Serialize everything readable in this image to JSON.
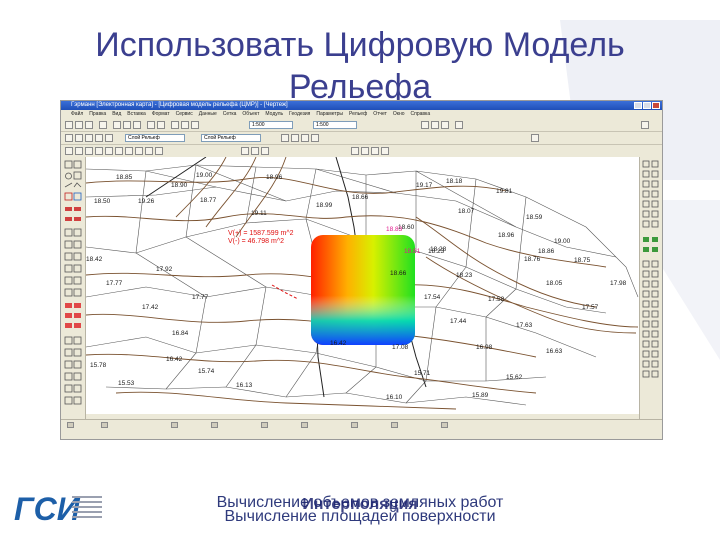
{
  "slide": {
    "title_line1": "Использовать Цифровую Модель",
    "title_line2": "Рельефа",
    "caption_line1": "Вычисление объемов земляных работ",
    "caption_line2": "Вычисление площадей поверхности",
    "caption_overlay": "Интерполяция",
    "logo_text": "ГСИ"
  },
  "window": {
    "title": "Гэрманн [Электронная карта] - [Цифровая модель рельефа (ЦМР)] - [Чертеж]",
    "menu": [
      "Файл",
      "Правка",
      "Вид",
      "Вставка",
      "Формат",
      "Сервис",
      "Данные",
      "Сетка",
      "Объект",
      "Модуль",
      "Геодезия",
      "Параметры",
      "Рельеф",
      "Отчет",
      "Окно",
      "Справка"
    ],
    "combo1": "1:500",
    "combo2": "1:500",
    "combo3": "Слой Рельеф",
    "combo4": "Слой Рельеф"
  },
  "map": {
    "volume1": "V(+) = 1587.599 m^2",
    "volume2": "V(-) = 46.798 m^2",
    "elevations": [
      "18.85",
      "19.00",
      "18.90",
      "18.96",
      "18.77",
      "18.99",
      "18.66",
      "19.17",
      "18.18",
      "19.81",
      "18.50",
      "19.26",
      "19.11",
      "18.60",
      "18.07",
      "18.59",
      "18.96",
      "19.00",
      "18.86",
      "18.42",
      "18.76",
      "18.75",
      "18.23",
      "18.66",
      "18.23",
      "17.77",
      "17.92",
      "18.05",
      "17.98",
      "17.77",
      "17.54",
      "17.58",
      "17.57",
      "17.42",
      "17.44",
      "17.63",
      "16.84",
      "16.42",
      "17.08",
      "16.98",
      "16.63",
      "15.78",
      "16.42",
      "15.71",
      "15.62",
      "15.53",
      "15.74",
      "16.13",
      "16.10",
      "15.89"
    ],
    "red_elevations": [
      "18.81",
      "18.28",
      "18.83"
    ]
  },
  "colors": {
    "title": "#3b3f8f",
    "caption": "#2f3a7c",
    "contour": "#7a5230",
    "tin_edge": "#555555",
    "volume_text": "#e01010",
    "accent_label": "#e0188c"
  }
}
